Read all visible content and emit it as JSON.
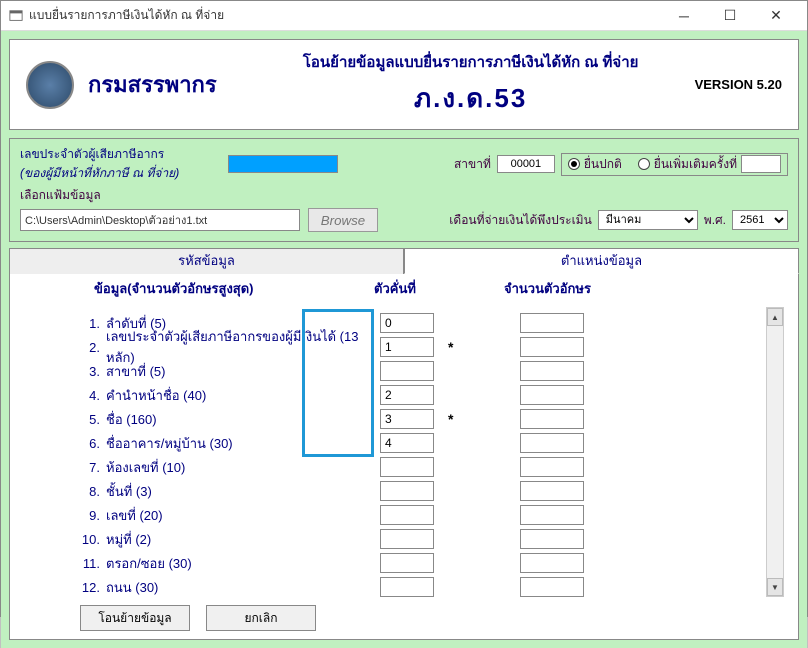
{
  "window": {
    "title": "แบบยื่นรายการภาษีเงินได้หัก ณ ที่จ่าย"
  },
  "header": {
    "dept": "กรมสรรพากร",
    "line1": "โอนย้ายข้อมูลแบบยื่นรายการภาษีเงินได้หัก ณ ที่จ่าย",
    "line2": "ภ.ง.ด.53",
    "version": "VERSION 5.20"
  },
  "info": {
    "tax_id_label": "เลขประจำตัวผู้เสียภาษีอากร",
    "tax_id_sub": "(ของผู้มีหน้าที่หักภาษี ณ ที่จ่าย)",
    "file_label": "เลือกแฟ้มข้อมูล",
    "file_value": "C:\\Users\\Admin\\Desktop\\ตัวอย่าง1.txt",
    "browse": "Browse",
    "branch_label": "สาขาที่",
    "branch_value": "00001",
    "radio_normal": "ยื่นปกติ",
    "radio_additional": "ยื่นเพิ่มเติมครั้งที่",
    "pay_month_label": "เดือนที่จ่ายเงินได้พึงประเมิน",
    "month_value": "มีนาคม",
    "year_label": "พ.ศ.",
    "year_value": "2561"
  },
  "tabs": {
    "t1": "รหัสข้อมูล",
    "t2": "ตำแหน่งข้อมูล"
  },
  "cols": {
    "c1": "ข้อมูล(จำนวนตัวอักษรสูงสุด)",
    "c2": "ตัวคั่นที่",
    "c3": "จำนวนตัวอักษร"
  },
  "rows": [
    {
      "n": "1.",
      "label": "ลำดับที่ (5)",
      "pos": "0",
      "ast": ""
    },
    {
      "n": "2.",
      "label": "เลขประจำตัวผู้เสียภาษีอากรของผู้มีเงินได้ (13 หลัก)",
      "pos": "1",
      "ast": "*"
    },
    {
      "n": "3.",
      "label": "สาขาที่ (5)",
      "pos": "",
      "ast": ""
    },
    {
      "n": "4.",
      "label": "คำนำหน้าชื่อ (40)",
      "pos": "2",
      "ast": ""
    },
    {
      "n": "5.",
      "label": "ชื่อ (160)",
      "pos": "3",
      "ast": "*"
    },
    {
      "n": "6.",
      "label": "ชื่ออาคาร/หมู่บ้าน (30)",
      "pos": "4",
      "ast": ""
    },
    {
      "n": "7.",
      "label": "ห้องเลขที่ (10)",
      "pos": "",
      "ast": ""
    },
    {
      "n": "8.",
      "label": "ชั้นที่ (3)",
      "pos": "",
      "ast": ""
    },
    {
      "n": "9.",
      "label": "เลขที่ (20)",
      "pos": "",
      "ast": ""
    },
    {
      "n": "10.",
      "label": "หมู่ที่ (2)",
      "pos": "",
      "ast": ""
    },
    {
      "n": "11.",
      "label": "ตรอก/ซอย (30)",
      "pos": "",
      "ast": ""
    },
    {
      "n": "12.",
      "label": "ถนน (30)",
      "pos": "",
      "ast": ""
    }
  ],
  "buttons": {
    "transfer": "โอนย้ายข้อมูล",
    "cancel": "ยกเลิก"
  }
}
